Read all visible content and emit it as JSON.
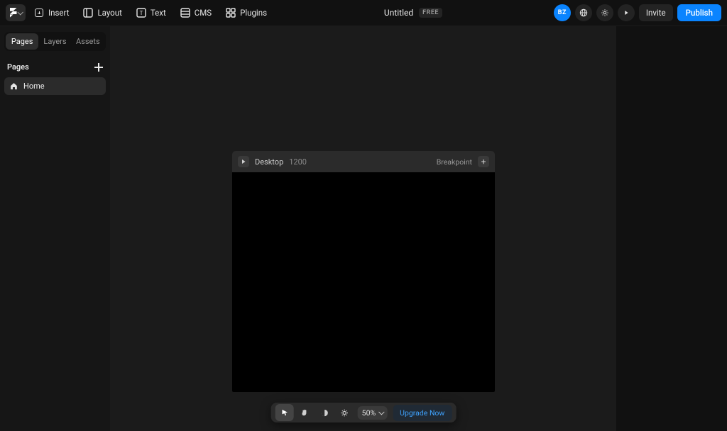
{
  "topbar": {
    "menu_items": {
      "insert": "Insert",
      "layout": "Layout",
      "text": "Text",
      "cms": "CMS",
      "plugins": "Plugins"
    },
    "title": "Untitled",
    "badge": "FREE",
    "avatar_initials": "BZ",
    "invite_label": "Invite",
    "publish_label": "Publish"
  },
  "panel": {
    "tabs": {
      "pages": "Pages",
      "layers": "Layers",
      "assets": "Assets"
    },
    "section_title": "Pages",
    "page_home": "Home"
  },
  "canvas": {
    "frame_name": "Desktop",
    "frame_width": "1200",
    "breakpoint_label": "Breakpoint"
  },
  "bottombar": {
    "zoom": "50%",
    "upgrade_label": "Upgrade Now"
  }
}
